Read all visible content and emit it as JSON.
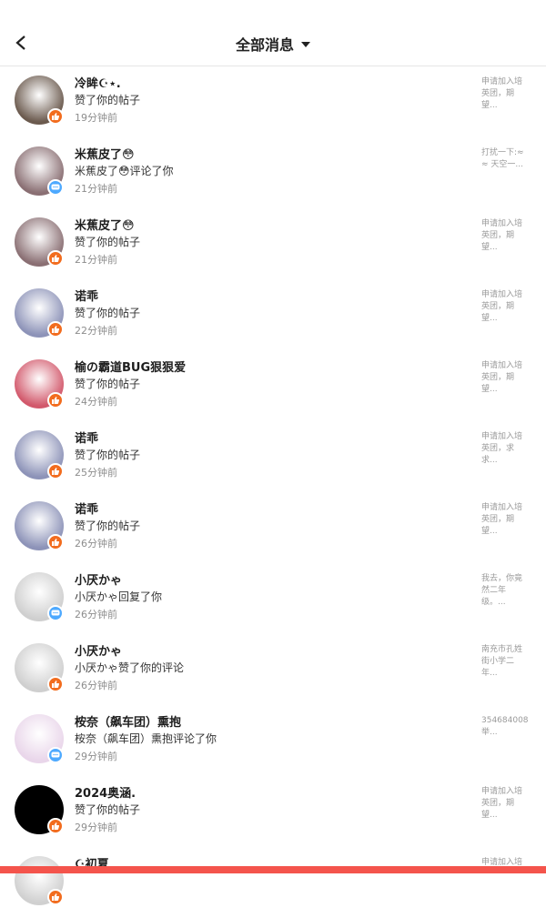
{
  "header": {
    "title": "全部消息"
  },
  "colors": {
    "like_badge": "#f26c1e",
    "comment_badge": "#4da9ff",
    "bottom_bar": "#f4544c"
  },
  "messages": [
    {
      "name": "冷眸☪⋆.",
      "action": "赞了你的帖子",
      "time": "19分钟前",
      "badge": "like-icon",
      "preview": "申请加入培英团，期望...",
      "avatar_color": "#6b5a4e"
    },
    {
      "name": "米蕉皮了😳",
      "action": "米蕉皮了😳评论了你",
      "time": "21分钟前",
      "badge": "comment-icon",
      "preview": "打扰一下:≈≈ 天空一...",
      "avatar_color": "#8a6f73"
    },
    {
      "name": "米蕉皮了😳",
      "action": "赞了你的帖子",
      "time": "21分钟前",
      "badge": "like-icon",
      "preview": "申请加入培英团，期望...",
      "avatar_color": "#8a6f73"
    },
    {
      "name": "诺乖",
      "action": "赞了你的帖子",
      "time": "22分钟前",
      "badge": "like-icon",
      "preview": "申请加入培英团，期望...",
      "avatar_color": "#8d93b8"
    },
    {
      "name": "榆の霸道BUG狠狠爱",
      "action": "赞了你的帖子",
      "time": "24分钟前",
      "badge": "like-icon",
      "preview": "申请加入培英团，期望...",
      "avatar_color": "#d2586b"
    },
    {
      "name": "诺乖",
      "action": "赞了你的帖子",
      "time": "25分钟前",
      "badge": "like-icon",
      "preview": "申请加入培英团，求求...",
      "avatar_color": "#8d93b8"
    },
    {
      "name": "诺乖",
      "action": "赞了你的帖子",
      "time": "26分钟前",
      "badge": "like-icon",
      "preview": "申请加入培英团，期望...",
      "avatar_color": "#8d93b8"
    },
    {
      "name": "小厌かゃ",
      "action": "小厌かゃ回复了你",
      "time": "26分钟前",
      "badge": "comment-icon",
      "preview": "我去，你竟然二年级。...",
      "avatar_color": "#cfcfcf"
    },
    {
      "name": "小厌かゃ",
      "action": "小厌かゃ赞了你的评论",
      "time": "26分钟前",
      "badge": "like-icon",
      "preview": "南充市孔姓街小学二年...",
      "avatar_color": "#cfcfcf"
    },
    {
      "name": "桉奈（飙车团）熏抱",
      "action": "桉奈（飙车团）熏抱评论了你",
      "time": "29分钟前",
      "badge": "comment-icon",
      "preview": "354684008举...",
      "avatar_color": "#e9d6ea"
    },
    {
      "name": "2024奥涵.",
      "action": "赞了你的帖子",
      "time": "29分钟前",
      "badge": "like-icon",
      "preview": "申请加入培英团，期望...",
      "avatar_color": "#000000"
    },
    {
      "name": "☪初夏",
      "action": "",
      "time": "",
      "badge": "like-icon",
      "preview": "申请加入培",
      "avatar_color": "#d0d0d0"
    }
  ]
}
